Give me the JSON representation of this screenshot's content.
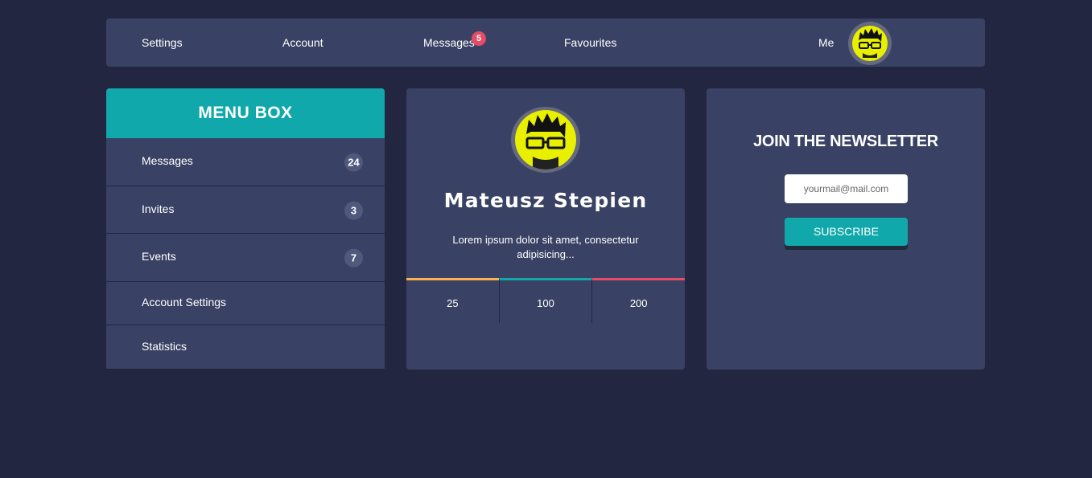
{
  "topnav": {
    "links": [
      {
        "label": "Settings"
      },
      {
        "label": "Account"
      },
      {
        "label": "Messages",
        "badge": "5"
      },
      {
        "label": "Favourites"
      }
    ],
    "me_label": "Me"
  },
  "menu_box": {
    "title": "MENU BOX",
    "items": [
      {
        "label": "Messages",
        "count": "24"
      },
      {
        "label": "Invites",
        "count": "3"
      },
      {
        "label": "Events",
        "count": "7"
      },
      {
        "label": "Account Settings"
      },
      {
        "label": "Statistics"
      }
    ]
  },
  "profile": {
    "name": "Mateusz Stepien",
    "description": "Lorem ipsum dolor sit amet, consectetur adipisicing...",
    "stats": [
      {
        "value": "25",
        "color": "#fcb150"
      },
      {
        "value": "100",
        "color": "#11a8ab"
      },
      {
        "value": "200",
        "color": "#e64c65"
      }
    ]
  },
  "newsletter": {
    "title": "JOIN THE NEWSLETTER",
    "placeholder": "yourmail@mail.com",
    "button_label": "SUBSCRIBE"
  },
  "colors": {
    "background": "#222640",
    "panel": "#394264",
    "accent": "#11a8ab",
    "badge": "#e64c65",
    "avatar_yellow": "#e8f000"
  }
}
